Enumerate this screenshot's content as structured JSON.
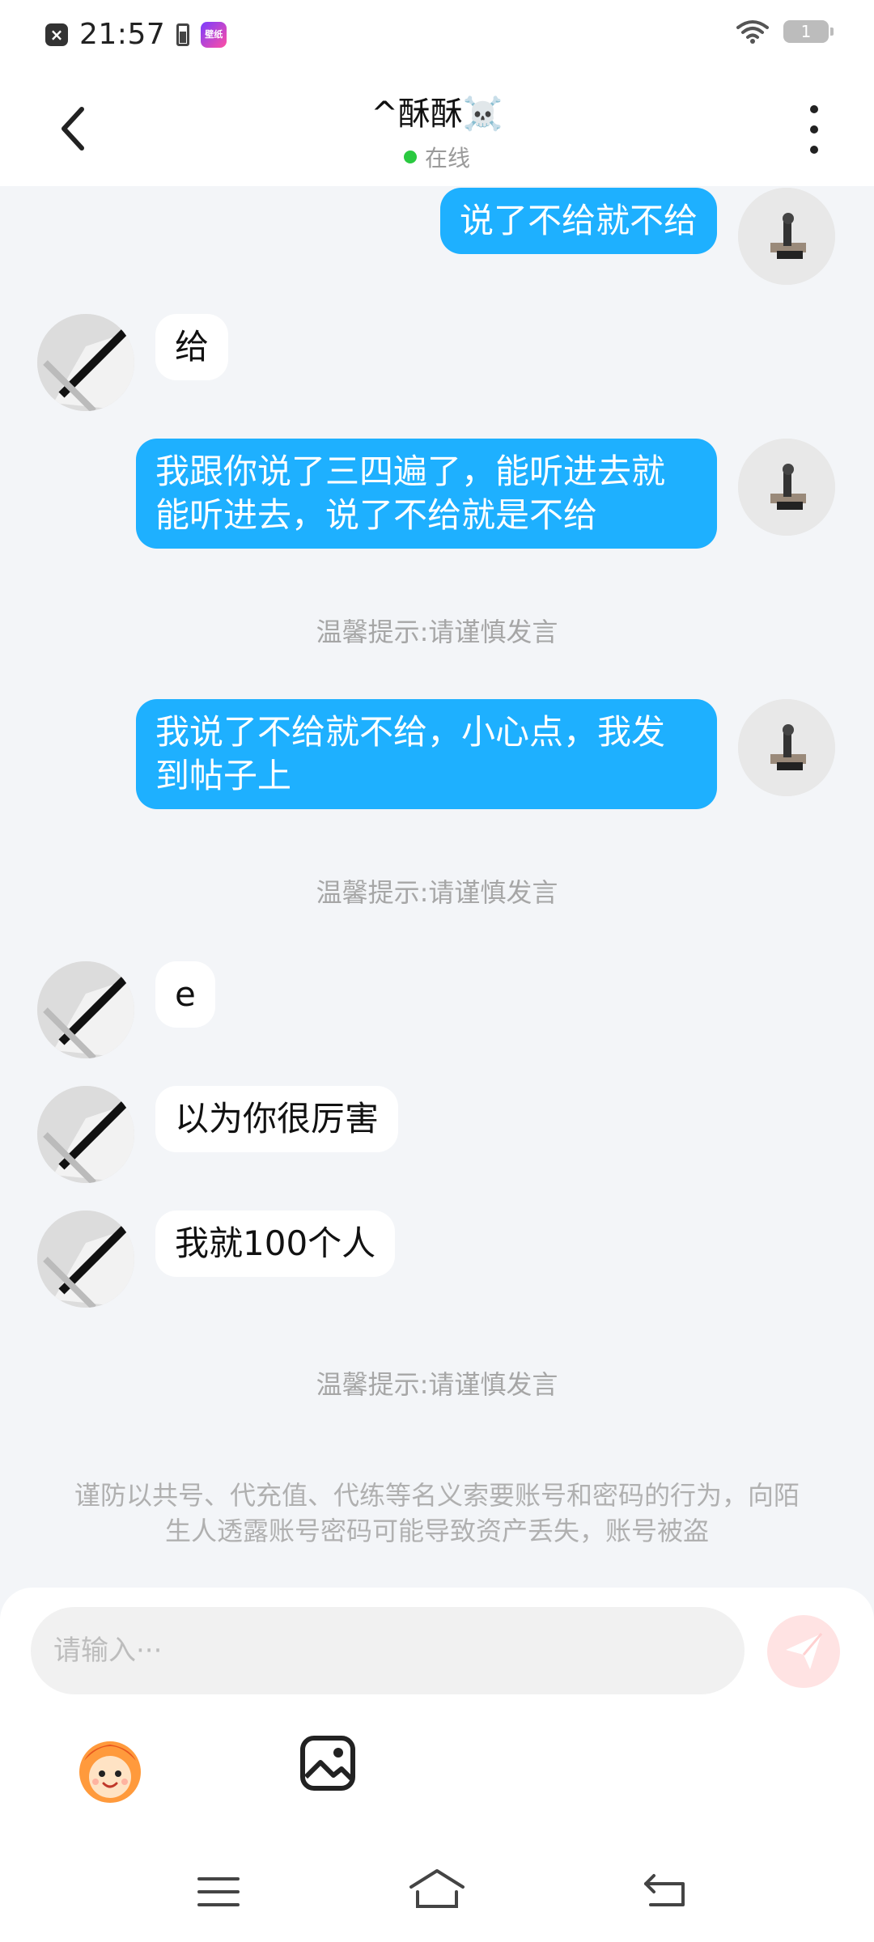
{
  "status_bar": {
    "time": "21:57",
    "app_badge": "壁纸",
    "battery": "1"
  },
  "header": {
    "title": "^酥酥☠️",
    "status": "在线"
  },
  "messages": [
    {
      "from": "me",
      "text": "说了不给就不给"
    },
    {
      "from": "other",
      "text": "给"
    },
    {
      "from": "me",
      "text": "我跟你说了三四遍了，能听进去就能听进去，说了不给就是不给"
    },
    {
      "from": "system",
      "text": "温馨提示:请谨慎发言"
    },
    {
      "from": "me",
      "text": "我说了不给就不给，小心点，我发到帖子上"
    },
    {
      "from": "system",
      "text": "温馨提示:请谨慎发言"
    },
    {
      "from": "other",
      "text": "e"
    },
    {
      "from": "other",
      "text": "以为你很厉害"
    },
    {
      "from": "other",
      "text": "我就100个人"
    },
    {
      "from": "system",
      "text": "温馨提示:请谨慎发言"
    }
  ],
  "warning": "谨防以共号、代充值、代练等名义索要账号和密码的行为，向陌生人透露账号密码可能导致资产丢失，账号被盗",
  "input": {
    "placeholder": "请输入···"
  },
  "icons": {
    "back": "back-arrow-icon",
    "more": "more-vertical-icon",
    "send": "send-icon",
    "emoji": "emoji-icon",
    "image": "image-icon",
    "nav_menu": "menu-icon",
    "nav_home": "home-icon",
    "nav_back": "back-gesture-icon"
  },
  "colors": {
    "my_bubble": "#1eb0ff",
    "other_bubble": "#ffffff",
    "background": "#f3f5f8",
    "online": "#2ac940",
    "send_disabled": "#ffe3e3"
  }
}
